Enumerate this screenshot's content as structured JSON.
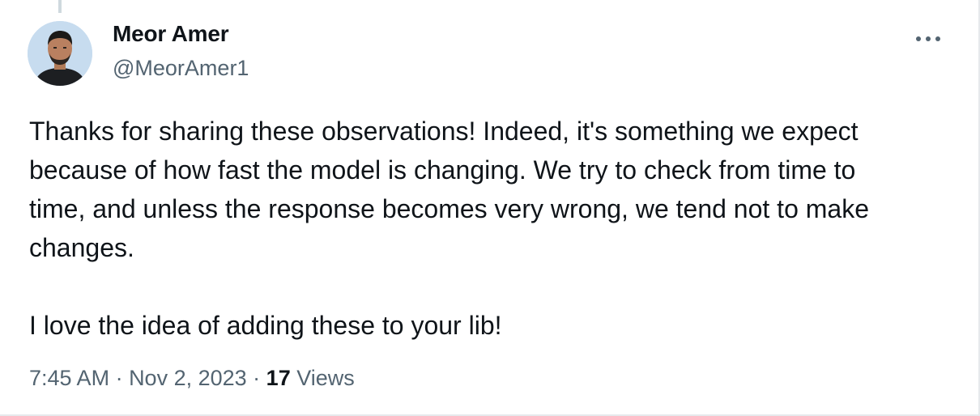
{
  "thread": {
    "connector_color": "#cfd9de"
  },
  "author": {
    "display_name": "Meor Amer",
    "handle": "@MeorAmer1",
    "avatar_icon": "user-avatar"
  },
  "menu": {
    "icon": "more-horizontal-icon"
  },
  "tweet": {
    "text": "Thanks for sharing these observations! Indeed, it's something we expect\nbecause of how fast the model is changing. We try to check from time to\ntime, and unless the response becomes very wrong, we tend not to make\nchanges.\n\nI love the idea of adding these to your lib!"
  },
  "meta": {
    "time": "7:45 AM",
    "separator": " · ",
    "date": "Nov 2, 2023",
    "views_count": "17",
    "views_label": " Views"
  },
  "colors": {
    "text_primary": "#0f1419",
    "text_secondary": "#536471",
    "border": "#e6e9ec",
    "avatar_bg": "#c7dcef"
  }
}
